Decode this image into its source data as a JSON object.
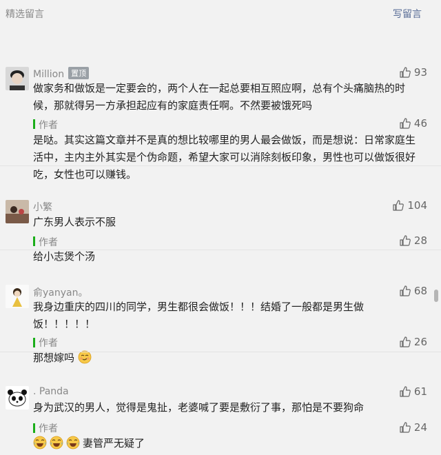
{
  "header": {
    "title": "精选留言",
    "write_label": "写留言"
  },
  "comments": [
    {
      "nickname": "Million",
      "badge": "置顶",
      "likes": "93",
      "content": "做家务和做饭是一定要会的，两个人在一起总要相互照应啊，总有个头痛脑热的时候，那就得另一方承担起应有的家庭责任啊。不然要被饿死吗",
      "reply": {
        "author": "作者",
        "likes": "46",
        "content": "是哒。其实这篇文章并不是真的想比较哪里的男人最会做饭，而是想说：日常家庭生活中，主内主外其实是个伪命题，希望大家可以消除刻板印象，男性也可以做饭很好吃，女性也可以赚钱。"
      }
    },
    {
      "nickname": "小繁",
      "likes": "104",
      "content": "广东男人表示不服",
      "reply": {
        "author": "作者",
        "likes": "28",
        "content": "给小志煲个汤"
      }
    },
    {
      "nickname": "俞yanyan。",
      "likes": "68",
      "content": "我身边重庆的四川的同学，男生都很会做饭！！！结婚了一般都是男生做饭！！！！！",
      "reply": {
        "author": "作者",
        "likes": "26",
        "content": "那想嫁吗"
      }
    },
    {
      "nickname": ". Panda",
      "likes": "61",
      "content": "身为武汉的男人，觉得是鬼扯，老婆喊了要是敷衍了事，那怕是不要狗命",
      "reply": {
        "author": "作者",
        "likes": "24",
        "content": "妻管严无疑了"
      }
    }
  ],
  "icons": {
    "like": "thumbs-up-icon",
    "emoji_smirk": "smirk-emoji-icon",
    "emoji_laugh": "tears-of-joy-emoji-icon"
  },
  "colors": {
    "link": "#576b95",
    "author_bar": "#1aad19"
  }
}
